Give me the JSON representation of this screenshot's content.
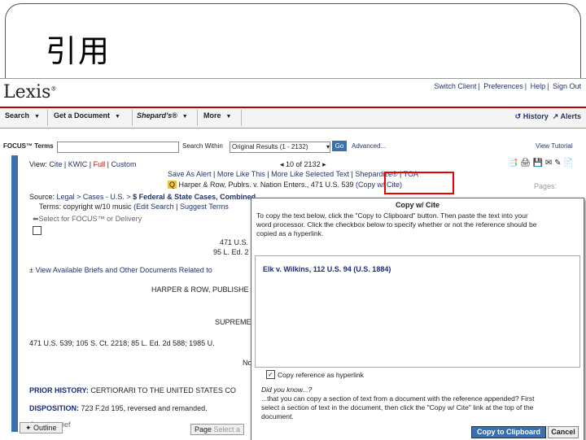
{
  "slide": {
    "title": "引用"
  },
  "lexis": {
    "logo": "Lexis",
    "logo_mark": "®",
    "toplinks": [
      "Switch Client",
      "Preferences",
      "Help",
      "Sign Out"
    ],
    "nav": [
      "Search",
      "Get a Document",
      "Shepard's®",
      "More"
    ],
    "nav_right": [
      "History",
      "Alerts"
    ],
    "focus_label": "FOCUS™ Terms",
    "search_within_label": "Search Within",
    "search_within_value": "Original Results (1 - 2132)",
    "go": "Go",
    "advanced": "Advanced...",
    "view_tutorial": "View Tutorial",
    "view_label": "View:",
    "views": [
      "Cite",
      "KWIC",
      "Full",
      "Custom"
    ],
    "pager": "10 of 2132",
    "actions": [
      "Save As Alert",
      "More Like This",
      "More Like Selected Text",
      "Shepardize®",
      "TOA"
    ],
    "doc_title": "Harper & Row, Publrs. v. Nation Enters., 471 U.S. 539",
    "copy_cite_link": "(Copy w/ Cite)",
    "pages": "Pages:",
    "source_label": "Source:",
    "source_path": "Legal > Cases - U.S. >",
    "source_rest": "$ Federal & State Cases, Combined",
    "terms_label": "Terms:",
    "terms_value": "copyright w/10 music",
    "edit_search": "(Edit Search",
    "suggest_terms": "Suggest Terms",
    "select_focus": "Select for FOCUS™ or Delivery",
    "cite_line1": "471 U.S.",
    "cite_line2": "95 L. Ed. 2",
    "view_briefs": "View Available Briefs and Other Documents Related to",
    "harper": "HARPER & ROW, PUBLISHE",
    "supreme": "SUPREME",
    "citation": "471 U.S. 539; 105 S. Ct. 2218; 85 L. Ed. 2d 588; 1985 U.",
    "no": "No",
    "prior_label": "PRIOR HISTORY:",
    "prior_value": "CERTIORARI TO THE UNITED STATES CO",
    "disp_label": "DISPOSITION:",
    "disp_value": "723 F.2d 195, reversed and remanded.",
    "case_summary": "Case in brief",
    "outline": "Outline",
    "page_tab": "Page",
    "select_tab": "Select a"
  },
  "modal": {
    "title": "Copy w/ Cite",
    "instructions_1": "To copy the text below, click the \"Copy to Clipboard\" button. Then paste the text into your",
    "instructions_2": "word processor. Click the checkbox below to specify whether or not the reference should be",
    "instructions_3": "copied as a hyperlink.",
    "cite_text": "Elk v. Wilkins, 112 U.S. 94 (U.S. 1884)",
    "checkbox_label": "Copy reference as hyperlink",
    "checkbox_mark": "✓",
    "didyou": "Did you know...?",
    "tip_1": "...that you can copy a section of text from a document with the reference appended? First",
    "tip_2": "select a section of text in the document, then click the \"Copy w/ Cite\" link at the top of the",
    "tip_3": "document.",
    "copy_btn": "Copy to Clipboard",
    "cancel_btn": "Cancel"
  }
}
